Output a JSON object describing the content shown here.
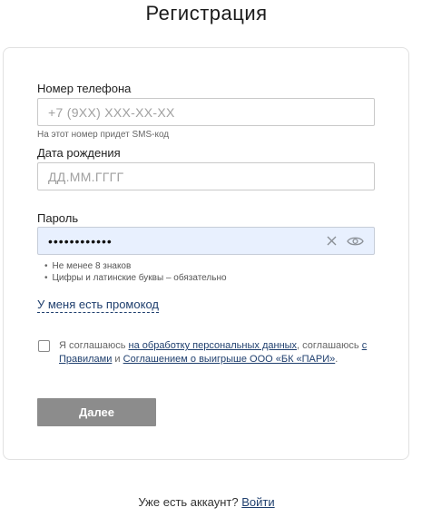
{
  "page": {
    "title": "Регистрация"
  },
  "form": {
    "phone": {
      "label": "Номер телефона",
      "placeholder": "+7 (9XX) XXX-XX-XX",
      "hint": "На этот номер придет SMS-код"
    },
    "birthdate": {
      "label": "Дата рождения",
      "placeholder": "ДД.ММ.ГГГГ"
    },
    "password": {
      "label": "Пароль",
      "value": "••••••••••••",
      "rules": [
        "Не менее 8 знаков",
        "Цифры и латинские буквы – обязательно"
      ],
      "clear_icon": "close-icon",
      "toggle_icon": "eye-icon"
    },
    "promo_link": "У меня есть промокод",
    "consent": {
      "checked": false,
      "text_1": "Я соглашаюсь ",
      "link_1": "на обработку персональных данных",
      "text_2": ", соглашаюсь ",
      "link_2": "с Правилами",
      "text_3": " и ",
      "link_3": "Соглашением о выигрыше ООО «БК «ПАРИ»",
      "text_4": "."
    },
    "submit_label": "Далее"
  },
  "footer": {
    "question": "Уже есть аккаунт?",
    "login_link": "Войти"
  }
}
